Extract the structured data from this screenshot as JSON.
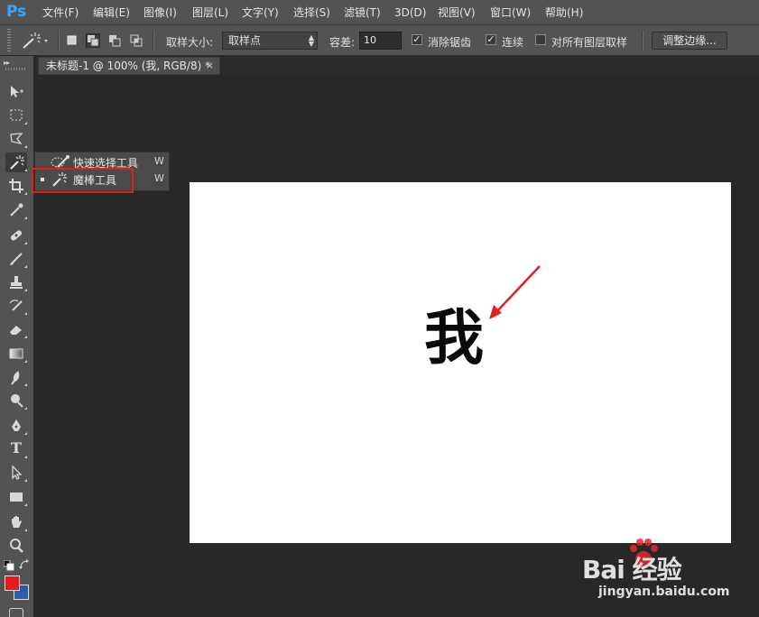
{
  "app": {
    "logo": "Ps",
    "accent_color": "#31a8ff"
  },
  "menubar": {
    "items": [
      "文件(F)",
      "编辑(E)",
      "图像(I)",
      "图层(L)",
      "文字(Y)",
      "选择(S)",
      "滤镜(T)",
      "3D(D)",
      "视图(V)",
      "窗口(W)",
      "帮助(H)"
    ]
  },
  "options": {
    "tool_icon": "magic-wand-icon",
    "sample_size_label": "取样大小:",
    "sample_size_value": "取样点",
    "tolerance_label": "容差:",
    "tolerance_value": "10",
    "anti_alias_label": "消除锯齿",
    "anti_alias_checked": true,
    "contiguous_label": "连续",
    "contiguous_checked": true,
    "sample_all_layers_label": "对所有图层取样",
    "sample_all_layers_checked": false,
    "refine_edge_label": "调整边缘..."
  },
  "document": {
    "tab_title": "未标题-1 @ 100% (我, RGB/8) *",
    "close_glyph": "×",
    "canvas_text": "我",
    "canvas_bg": "#ffffff",
    "annotation_color": "#e02020"
  },
  "toolbar": {
    "collapse_glyph": "▸▸",
    "tools": [
      "move-icon",
      "marquee-icon",
      "lasso-icon",
      "magic-wand-icon",
      "crop-icon",
      "eyedropper-icon",
      "healing-brush-icon",
      "brush-icon",
      "clone-stamp-icon",
      "history-brush-icon",
      "eraser-icon",
      "gradient-icon",
      "blur-icon",
      "dodge-icon",
      "pen-icon",
      "type-icon",
      "path-selection-icon",
      "rectangle-icon",
      "hand-icon",
      "zoom-icon"
    ],
    "type_tool_glyph": "T",
    "foreground_color": "#e51c1c",
    "background_color": "#2a5fa8"
  },
  "flyout": {
    "items": [
      {
        "label": "快速选择工具",
        "shortcut": "W",
        "icon": "quick-selection-icon",
        "selected": false
      },
      {
        "label": "魔棒工具",
        "shortcut": "W",
        "icon": "magic-wand-icon",
        "selected": true
      }
    ]
  },
  "watermark": {
    "brand": "Bai 经验",
    "url": "jingyan.baidu.com"
  }
}
